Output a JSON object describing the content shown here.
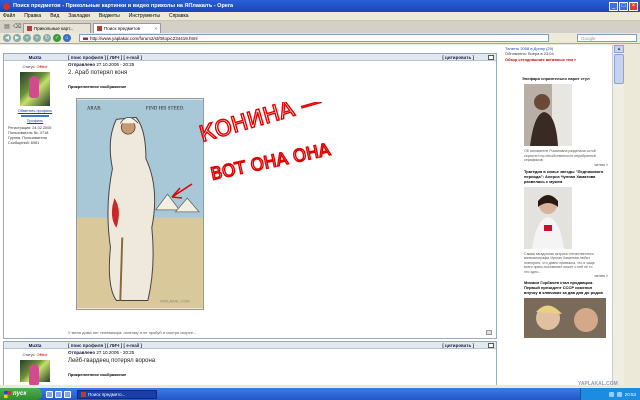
{
  "window": {
    "title": "Поиск предметов - Прикольные картинки и видео приколы на ЯПлакалъ - Opera",
    "controls": [
      "_",
      "□",
      "×"
    ]
  },
  "menu": [
    "Файл",
    "Правка",
    "Вид",
    "Закладки",
    "Виджеты",
    "Инструменты",
    "Справка"
  ],
  "tabs": [
    {
      "label": "Прикольные карт...",
      "active": false
    },
    {
      "label": "Поиск предметов",
      "active": true
    }
  ],
  "address": {
    "url": "http://www.yaplakal.com/forum2/st/0/topic234419.html",
    "search_placeholder": "Google"
  },
  "post1": {
    "nick": "Muzta",
    "header_links": "[ поис профиля ] [ ЛИЧ ] [ e-mail ]",
    "reply_label": "[ цитировать ]",
    "status_label": "Статус:",
    "status_value": "Offline",
    "reputation_link": "Обменять профиль",
    "profile_link": "Профиль",
    "reg": "Регистрация: 24.02.2005",
    "points": "Пользователь №: 3718",
    "group": "Группа: Пользователи",
    "posts": "Сообщений: 6981",
    "posted_label": "Отправлено",
    "posted_date": "27.10.2006 - 20:25",
    "message": "2. Араб потерял коня",
    "quote_label": "Прикрепленное изображение",
    "cartoon_text_left": "ARAB.",
    "cartoon_text_right": "FIND HIS STEED.",
    "scribble_1": "КОНИНА —",
    "scribble_2": "ВОТ ОНА ОНА",
    "cartoon_watermark": "YAPLAKAL.COM",
    "footer": "У меня дома нет телевизора: поэтому я не пробуй и смотри скорее..."
  },
  "post2": {
    "nick": "Muzta",
    "header_links": "[ поис профиля ] [ ЛИЧ ] [ e-mail ]",
    "reply_label": "[ цитировать ]",
    "status_label": "Статус:",
    "status_value": "Offline",
    "posted_label": "Отправлено",
    "posted_date": "27.10.2006 - 20:25",
    "message": "Лейб-гвардеец потерял ворона",
    "quote_label": "Прикрепленное изображение"
  },
  "sidebar": {
    "top_line": "Таганть 2008 в Донну (29)",
    "updated": "Обновлено: Вчера в 23:04",
    "hot_link": "Обзор сегодняшних активных тем »",
    "item1_title": "Элефара сприятельно парит стул",
    "item1_caption": "Об основателе Романовна разделала сотой серия его по-несобственности перебранной серафимов",
    "read_more": "читать »",
    "item2_title": "Трагедия в семье звезды \"Ледникового периода\": Алерса Чулпан Хаматова развелась с мужем",
    "item2_caption": "Самая загадочная актриса отечественного кинематографа Чулпан Хаматова любит повторять, что давно привыкла, что я чаще всего пресс-поставляет пишет о ней не то что одно...",
    "item3_title": "Михаил Горбачев стал продавцом. Первый президент СССР изменил внучку в ключиках за два дня до родов"
  },
  "taskbar": {
    "start": "пуск",
    "task": "Поиск предмето...",
    "clock": "20:53"
  },
  "watermark": "YAPLAKAL.COM",
  "colors": {
    "offline": "#cc0000",
    "scribble": "#e00000",
    "link": "#1a3ca8"
  }
}
